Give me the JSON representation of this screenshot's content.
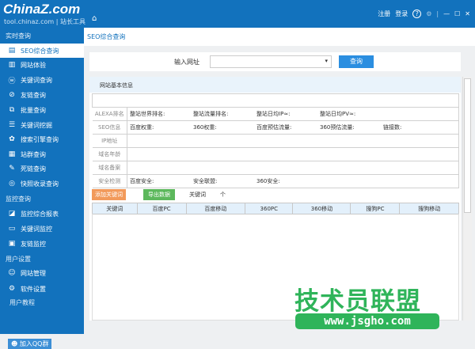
{
  "header": {
    "logo": "ChinaZ.com",
    "logo_sub": "tool.chinaz.com | 站长工具",
    "register": "注册",
    "login": "登录"
  },
  "sidebar": {
    "sections": [
      "实时查询",
      "监控查询",
      "用户设置"
    ],
    "items": [
      {
        "label": "SEO综合查询",
        "icon": "doc-icon"
      },
      {
        "label": "网站体验",
        "icon": "chart-icon"
      },
      {
        "label": "关键词查询",
        "icon": "keyword-icon"
      },
      {
        "label": "友链查询",
        "icon": "link-icon"
      },
      {
        "label": "批量查询",
        "icon": "batch-icon"
      },
      {
        "label": "关键词挖掘",
        "icon": "list-icon"
      },
      {
        "label": "搜索引擎查询",
        "icon": "paw-icon"
      },
      {
        "label": "站群查询",
        "icon": "stats-icon"
      },
      {
        "label": "死链查询",
        "icon": "edit-icon"
      },
      {
        "label": "快照收录查询",
        "icon": "camera-icon"
      },
      {
        "label": "监控综合报表",
        "icon": "report-icon"
      },
      {
        "label": "关键词监控",
        "icon": "monitor-icon"
      },
      {
        "label": "友链监控",
        "icon": "link-monitor-icon"
      },
      {
        "label": "网站管理",
        "icon": "user-icon"
      },
      {
        "label": "软件设置",
        "icon": "gear-icon"
      }
    ],
    "tutorial": "用户教程",
    "qq": "加入QQ群"
  },
  "page_title": "SEO综合查询",
  "search": {
    "label": "输入网址",
    "value": "",
    "button": "查询"
  },
  "info": {
    "title": "网站基本信息",
    "rows": [
      {
        "label": "ALEXA排名",
        "cells": [
          "整站世界排名:",
          "整站流量排名:",
          "整站日均IP≈:",
          "整站日均PV≈:"
        ]
      },
      {
        "label": "SEO信息",
        "cells": [
          "百度权重:",
          "360权重:",
          "百度预估流量:",
          "360预估流量:",
          "链接数:"
        ]
      },
      {
        "label": "IP地址",
        "cells": []
      },
      {
        "label": "域名年龄",
        "cells": []
      },
      {
        "label": "域名备案",
        "cells": []
      },
      {
        "label": "安全检测",
        "cells": [
          "百度安全:",
          "安全联盟:",
          "360安全:"
        ]
      }
    ]
  },
  "keywords": {
    "add": "添加关键词",
    "export": "导出数据",
    "count_label": "关键词",
    "count_unit": "个",
    "columns": [
      "关键词",
      "百度PC",
      "百度移动",
      "360PC",
      "360移动",
      "搜狗PC",
      "搜狗移动"
    ]
  },
  "watermark": {
    "text": "技术员联盟",
    "url": "www.jsgho.com"
  }
}
